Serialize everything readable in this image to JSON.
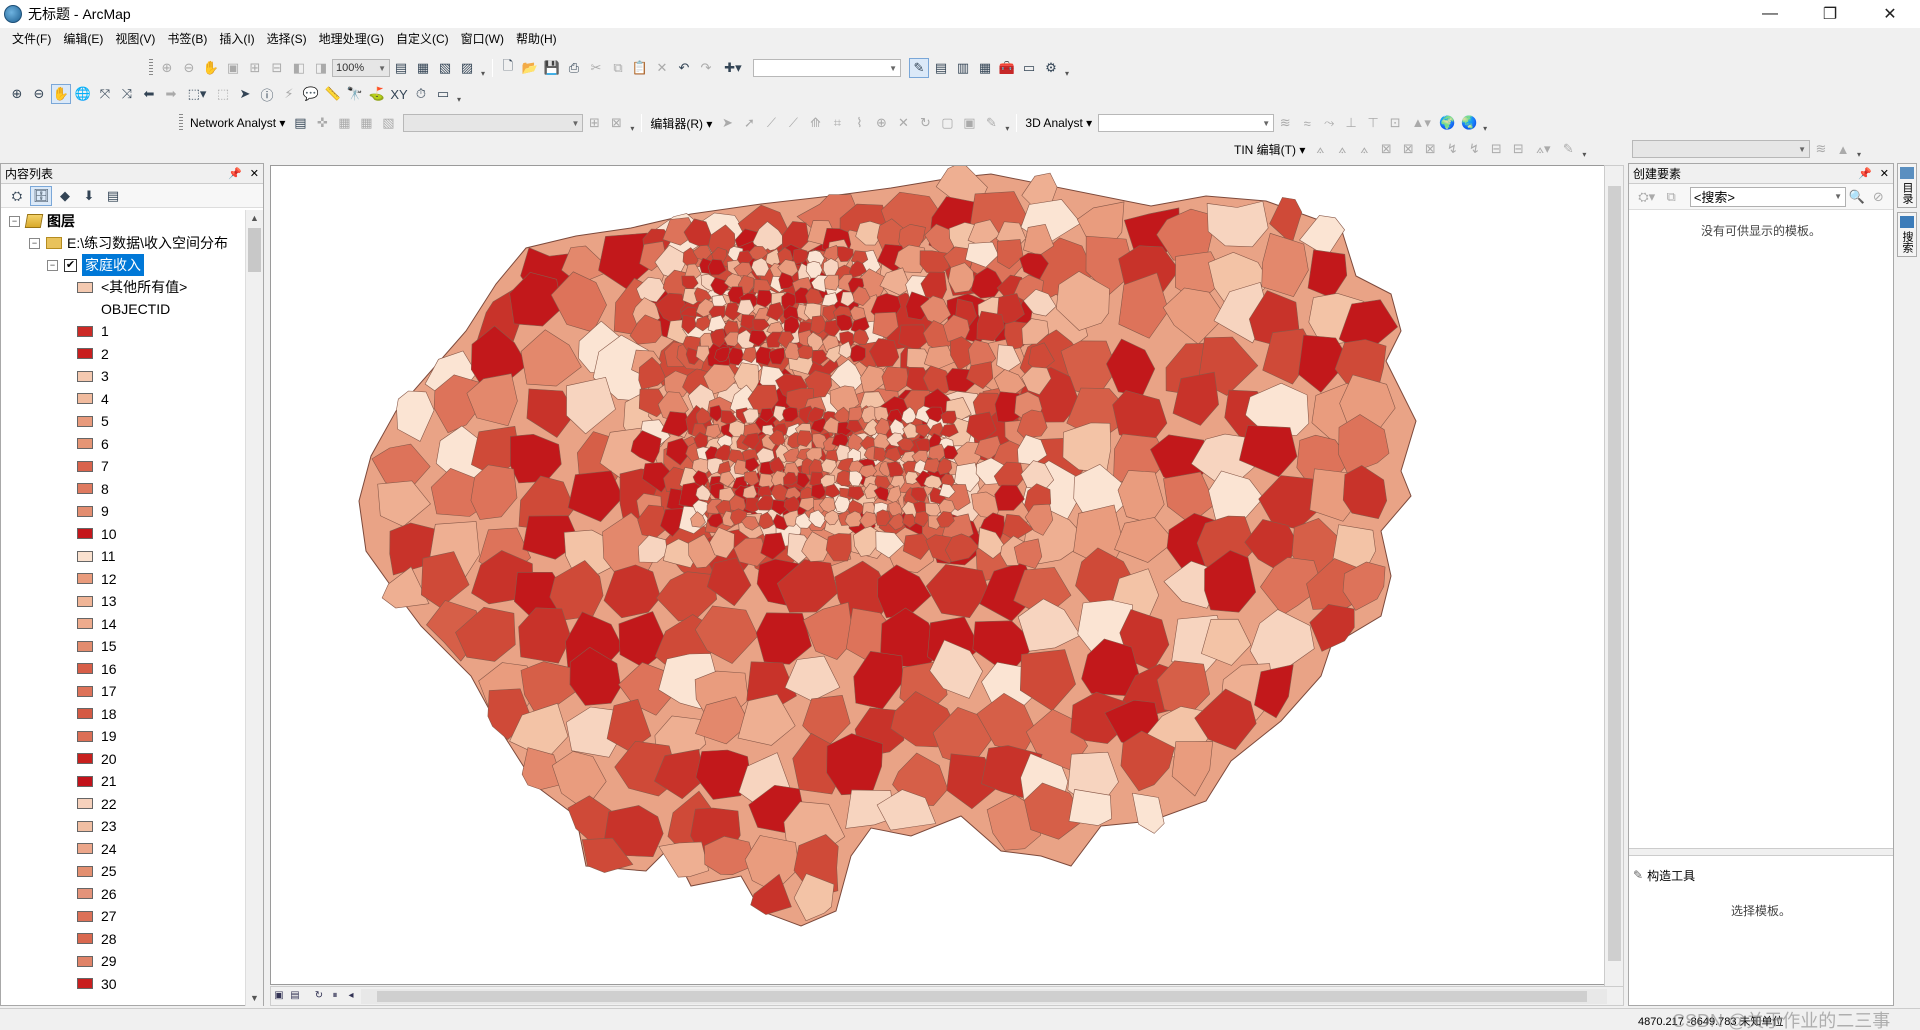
{
  "window": {
    "title": "无标题 - ArcMap",
    "controls": [
      "—",
      "❐",
      "✕"
    ]
  },
  "menu": [
    "文件(F)",
    "编辑(E)",
    "视图(V)",
    "书签(B)",
    "插入(I)",
    "选择(S)",
    "地理处理(G)",
    "自定义(C)",
    "窗口(W)",
    "帮助(H)"
  ],
  "toolbars": {
    "zoom_value": "100%",
    "network_analyst_label": "Network Analyst ▾",
    "editor_label": "编辑器(R) ▾",
    "analyst3d_label": "3D Analyst ▾",
    "tin_label": "TIN 编辑(T) ▾"
  },
  "toc": {
    "title": "内容列表",
    "root_label": "图层",
    "folder_label": "E:\\练习数据\\收入空间分布",
    "layer_label": "家庭收入",
    "layer_checked": "✔",
    "other_values_label": "<其他所有值>",
    "field_label": "OBJECTID",
    "legend": [
      {
        "label": "1",
        "color": "#cc2a26"
      },
      {
        "label": "2",
        "color": "#c81e1e"
      },
      {
        "label": "3",
        "color": "#f4c9b0"
      },
      {
        "label": "4",
        "color": "#f1bb9e"
      },
      {
        "label": "5",
        "color": "#e89a7c"
      },
      {
        "label": "6",
        "color": "#e59575"
      },
      {
        "label": "7",
        "color": "#d9634c"
      },
      {
        "label": "8",
        "color": "#df7a60"
      },
      {
        "label": "9",
        "color": "#e38d70"
      },
      {
        "label": "10",
        "color": "#c4161b"
      },
      {
        "label": "11",
        "color": "#fae1cf"
      },
      {
        "label": "12",
        "color": "#e99b7c"
      },
      {
        "label": "13",
        "color": "#f0b597"
      },
      {
        "label": "14",
        "color": "#eeab8d"
      },
      {
        "label": "15",
        "color": "#e38c6e"
      },
      {
        "label": "16",
        "color": "#d75e48"
      },
      {
        "label": "17",
        "color": "#dd7259"
      },
      {
        "label": "18",
        "color": "#d45a44"
      },
      {
        "label": "19",
        "color": "#dc6f56"
      },
      {
        "label": "20",
        "color": "#c8201e"
      },
      {
        "label": "21",
        "color": "#c2121a"
      },
      {
        "label": "22",
        "color": "#f6d1bc"
      },
      {
        "label": "23",
        "color": "#f1bfa3"
      },
      {
        "label": "24",
        "color": "#eca68a"
      },
      {
        "label": "25",
        "color": "#e38f70"
      },
      {
        "label": "26",
        "color": "#e4937a"
      },
      {
        "label": "27",
        "color": "#dc7158"
      },
      {
        "label": "28",
        "color": "#d9684f"
      },
      {
        "label": "29",
        "color": "#e08368"
      },
      {
        "label": "30",
        "color": "#c91f1f"
      }
    ]
  },
  "map": {
    "palette": [
      "#fbe4d3",
      "#f7d4bf",
      "#f3c3a6",
      "#eeaf92",
      "#e99c7e",
      "#e3886c",
      "#dd735a",
      "#d65f48",
      "#cf4a38",
      "#c8332a",
      "#c2181b"
    ]
  },
  "create_features": {
    "title": "创建要素",
    "search_placeholder": "<搜索>",
    "empty_message": "没有可供显示的模板。",
    "tools_title": "构造工具",
    "tools_message": "选择模板。"
  },
  "side_tabs": [
    "目录",
    "搜索"
  ],
  "statusbar": {
    "coordinates": "4870.217  -8649.783 未知单位",
    "watermark": "CSDN @关于作业的二三事"
  }
}
